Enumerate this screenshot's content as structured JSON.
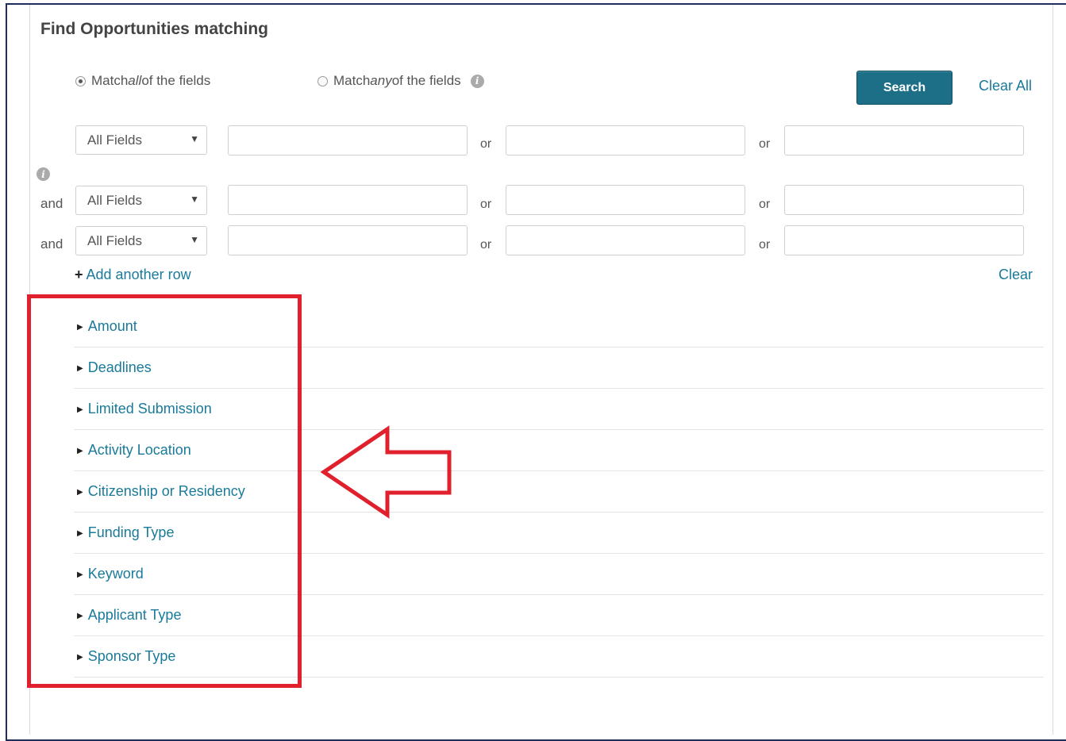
{
  "header": {
    "title": "Find Opportunities matching"
  },
  "match": {
    "all": {
      "pre": "Match ",
      "em": "all",
      "post": " of the fields",
      "checked": true
    },
    "any": {
      "pre": "Match ",
      "em": "any",
      "post": " of the fields",
      "checked": false
    },
    "info_icon": "i"
  },
  "toolbar": {
    "search_label": "Search",
    "clear_all_label": "Clear All"
  },
  "rows": [
    {
      "connector": "",
      "field": "All Fields",
      "values": [
        "",
        "",
        ""
      ]
    },
    {
      "connector": "and",
      "field": "All Fields",
      "values": [
        "",
        "",
        ""
      ]
    },
    {
      "connector": "and",
      "field": "All Fields",
      "values": [
        "",
        "",
        ""
      ]
    }
  ],
  "or_label": "or",
  "side_info_icon": "i",
  "add_row": {
    "plus": "+",
    "label": "Add another row"
  },
  "clear_label": "Clear",
  "facets": [
    "Amount",
    "Deadlines",
    "Limited Submission",
    "Activity Location",
    "Citizenship or Residency",
    "Funding Type",
    "Keyword",
    "Applicant Type",
    "Sponsor Type"
  ],
  "colors": {
    "accent": "#1d6f87",
    "link": "#1a7a9a",
    "annotation": "#e0202c"
  }
}
